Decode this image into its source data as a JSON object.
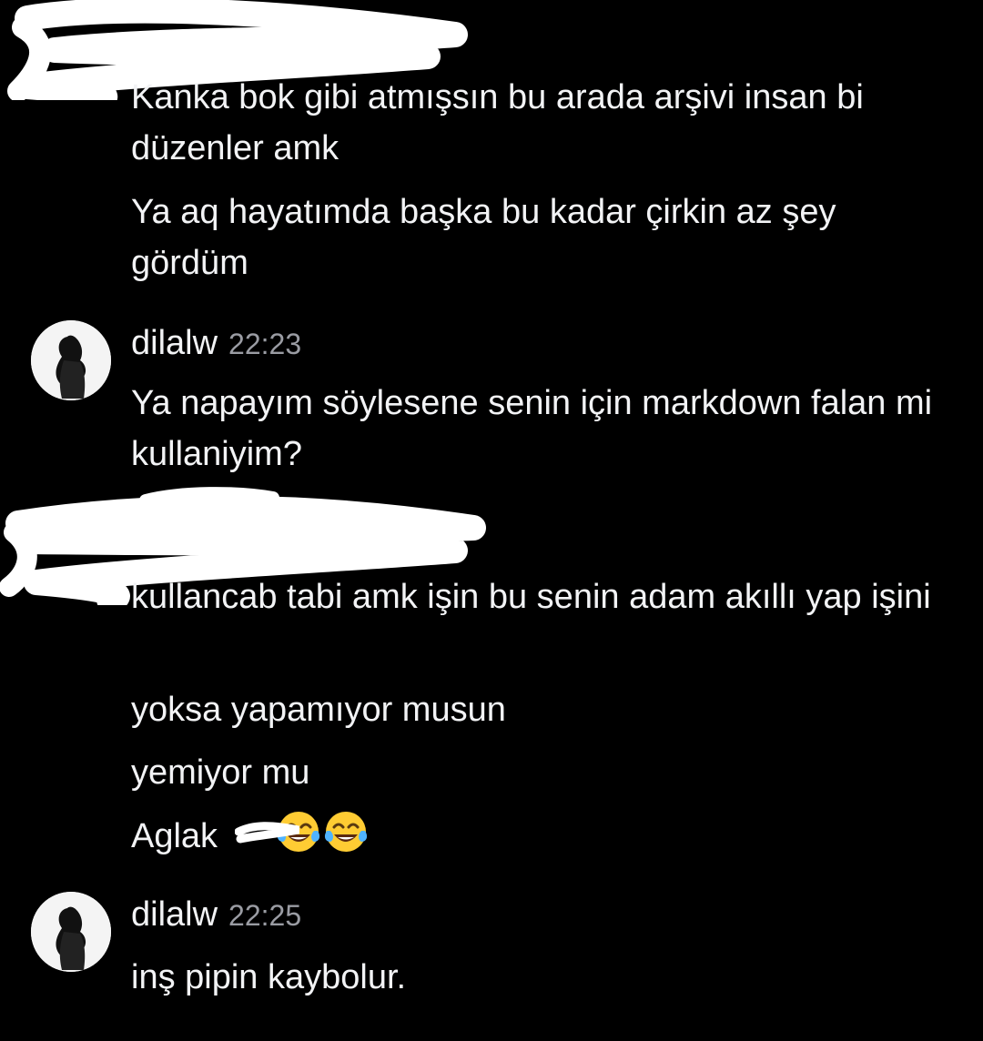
{
  "messages_top": [
    "Kanka bok gibi atmışsın bu arada arşivi insan bi düzenler amk",
    "Ya aq hayatımda başka bu kadar çirkin az şey gördüm"
  ],
  "group1": {
    "author": "dilalw",
    "time": "22:23",
    "lines": [
      "Ya napayım söylesene senin için markdown falan mi kullaniyim?"
    ]
  },
  "messages_middle": [
    "kullancab tabi amk işin bu senin adam akıllı yap işini",
    "yoksa yapamıyor musun",
    "yemiyor mu",
    "Aglak"
  ],
  "group2": {
    "author": "dilalw",
    "time": "22:25",
    "lines": [
      "inş pipin kaybolur."
    ]
  },
  "icons": {
    "emoji": "face-with-tears-of-joy-icon",
    "avatar": "user-avatar"
  },
  "colors": {
    "background": "#000000",
    "text": "#f2f3f5",
    "timestamp": "#9a9ca3"
  }
}
